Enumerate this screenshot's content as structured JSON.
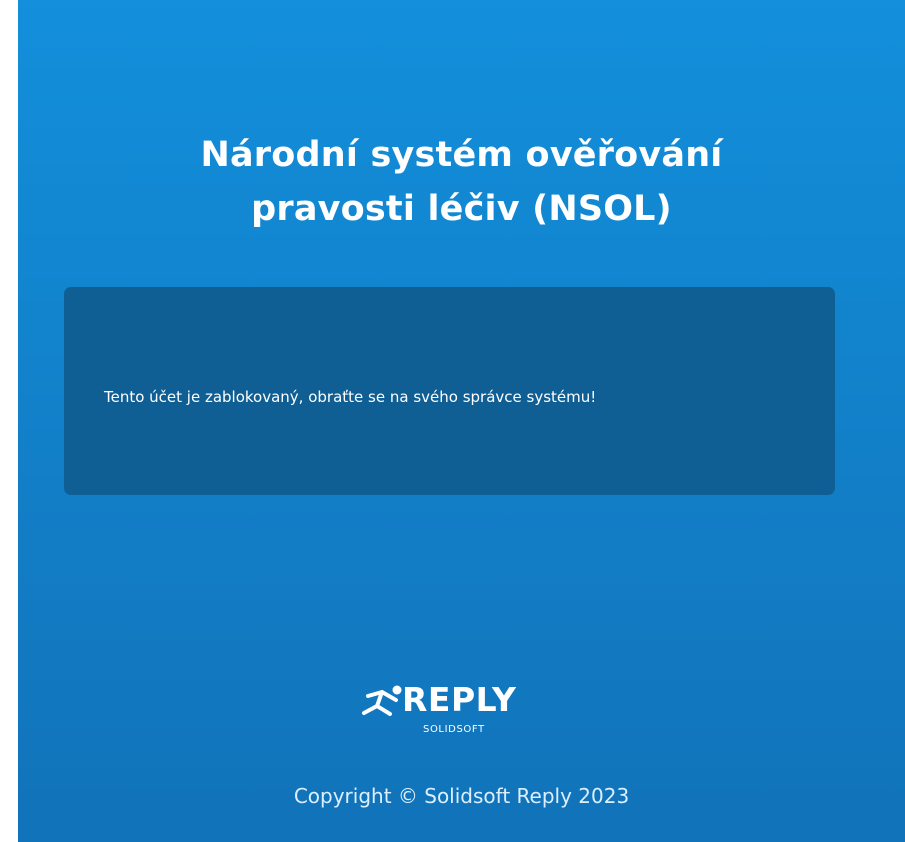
{
  "page": {
    "title_line1": "Národní systém ověřování",
    "title_line2": "pravosti léčiv (NSOL)"
  },
  "alert": {
    "message": "Tento účet je zablokovaný, obraťte se na svého správce systému!"
  },
  "logo": {
    "icon": "running-figure-icon",
    "main": "REPLY",
    "sub": "SOLIDSOFT"
  },
  "footer": {
    "copyright": "Copyright © Solidsoft Reply 2023"
  },
  "colors": {
    "background_top": "#138fdb",
    "background_bottom": "#1173b9",
    "message_box": "#0f5f94",
    "text": "#ffffff"
  }
}
